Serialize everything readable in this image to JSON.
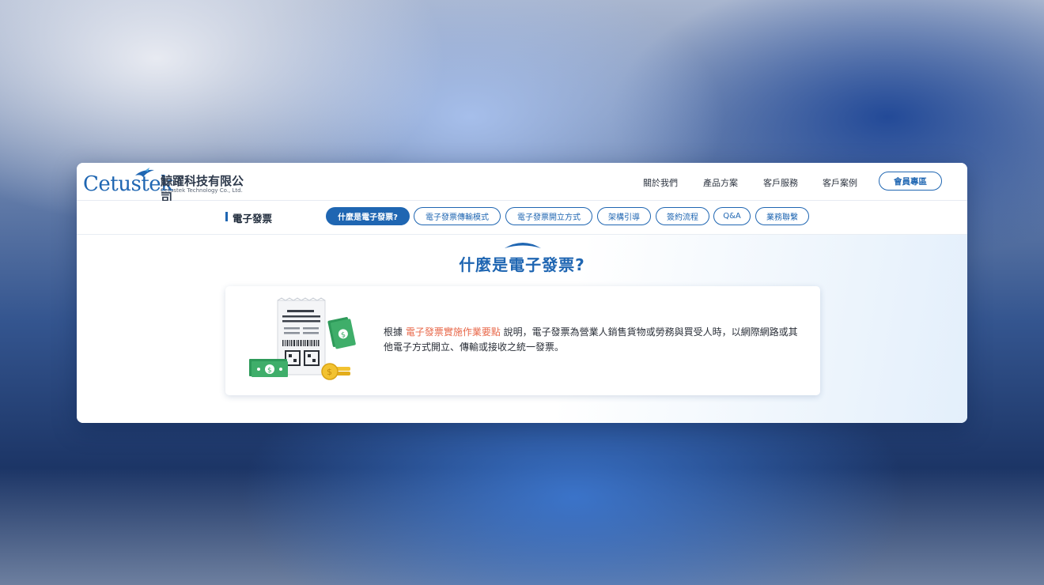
{
  "brand": {
    "logo_word": "Cetustek",
    "name_cn": "鯨躍科技有限公司",
    "name_en": "Cetustek Technology Co., Ltd."
  },
  "header": {
    "nav": [
      "關於我們",
      "產品方案",
      "客戶服務",
      "客戶案例"
    ],
    "member_button": "會員專區"
  },
  "subnav": {
    "section_title": "電子發票",
    "tabs": [
      {
        "label": "什麼是電子發票?",
        "active": true
      },
      {
        "label": "電子發票傳輸模式",
        "active": false
      },
      {
        "label": "電子發票開立方式",
        "active": false
      },
      {
        "label": "架構引導",
        "active": false
      },
      {
        "label": "簽約流程",
        "active": false
      },
      {
        "label": "Q&A",
        "active": false
      },
      {
        "label": "業務聯繫",
        "active": false
      }
    ]
  },
  "main": {
    "heading": "什麼是電子發票?",
    "desc_prefix": "根據 ",
    "desc_link": "電子發票實施作業要點",
    "desc_suffix": " 說明，電子發票為營業人銷售貨物或勞務與買受人時，以網際網路或其他電子方式開立、傳輸或接收之統一發票。"
  },
  "colors": {
    "brand_blue": "#1f66b2",
    "link_orange": "#e8684a",
    "money_green": "#3fae6a",
    "coin_gold": "#f2c230"
  },
  "icons": {
    "logo_bird": "whale-bird-icon",
    "illustration": "receipt-money-illustration",
    "arc": "arc-icon"
  }
}
